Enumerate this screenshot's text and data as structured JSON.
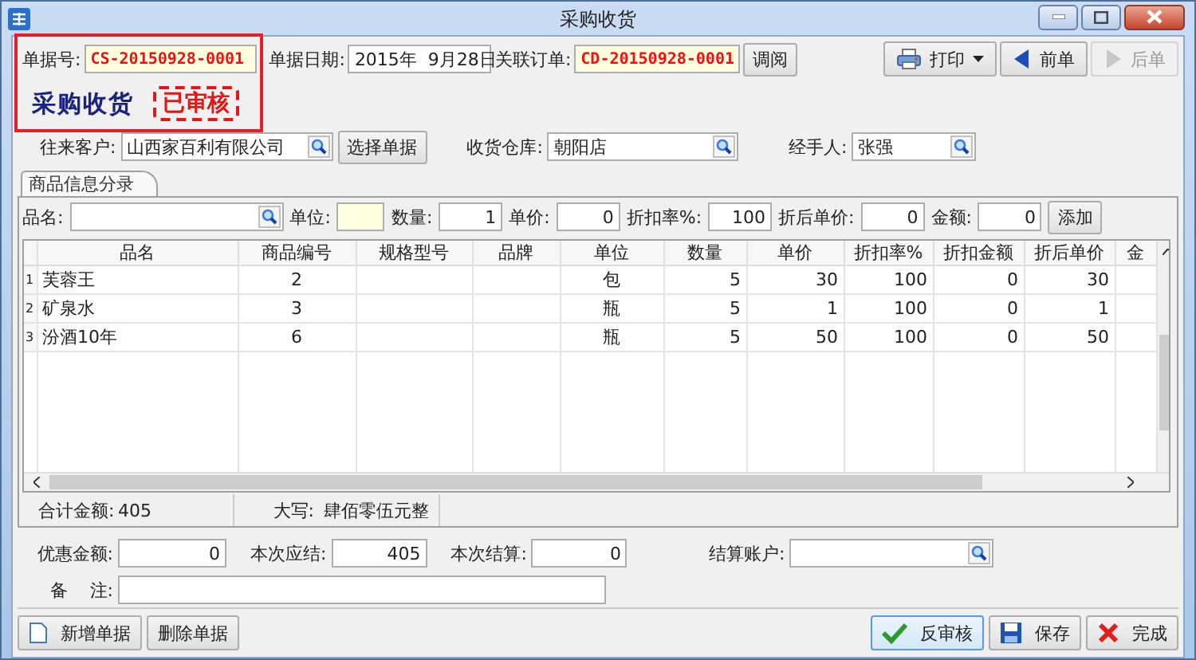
{
  "window": {
    "title": "采购收货"
  },
  "header": {
    "doc_no": {
      "label": "单据号:",
      "value": "CS-20150928-0001"
    },
    "date": {
      "label": "单据日期:",
      "value": "2015年  9月28日"
    },
    "related_order": {
      "label": "关联订单:",
      "value": "CD-20150928-0001"
    },
    "view_button": "调阅"
  },
  "toolbar": [
    {
      "label": "打印",
      "kind": "print",
      "disabled": false
    },
    {
      "label": "前单",
      "kind": "prev",
      "disabled": false
    },
    {
      "label": "后单",
      "kind": "next",
      "disabled": true
    }
  ],
  "doc_title": "采购收货",
  "status_stamp": "已审核",
  "party": {
    "customer": {
      "label": "往来客户:",
      "value": "山西家百利有限公司"
    },
    "select_button": "选择单据",
    "warehouse": {
      "label": "收货仓库:",
      "value": "朝阳店"
    },
    "handler": {
      "label": "经手人:",
      "value": "张强"
    }
  },
  "tabs": [
    {
      "label": "商品信息分录",
      "selected": true
    }
  ],
  "entry": {
    "fields": [
      {
        "label": "品名:",
        "kind": "lookup"
      },
      {
        "label": "单位:",
        "kind": "unit"
      },
      {
        "label": "数量:",
        "value": "1",
        "kind": "number"
      },
      {
        "label": "单价:",
        "value": "0",
        "kind": "number"
      },
      {
        "label": "折扣率%:",
        "value": "100",
        "kind": "number"
      },
      {
        "label": "折后单价:",
        "value": "0",
        "kind": "number"
      },
      {
        "label": "金额:",
        "value": "0",
        "kind": "number"
      }
    ],
    "add_button": "添加"
  },
  "table": {
    "columns": [
      "品名",
      "商品编号",
      "规格型号",
      "品牌",
      "单位",
      "数量",
      "单价",
      "折扣率%",
      "折扣金额",
      "折后单价",
      "金"
    ],
    "rows": [
      {
        "number": "1",
        "name": "芙蓉王",
        "code": "2",
        "unit": "包",
        "qty": "5",
        "price": "30",
        "discount_rate": "100",
        "discount_amount": "0",
        "net_price": "30"
      },
      {
        "number": "2",
        "name": "矿泉水",
        "code": "3",
        "unit": "瓶",
        "qty": "5",
        "price": "1",
        "discount_rate": "100",
        "discount_amount": "0",
        "net_price": "1"
      },
      {
        "number": "3",
        "name": "汾酒10年",
        "code": "6",
        "unit": "瓶",
        "qty": "5",
        "price": "50",
        "discount_rate": "100",
        "discount_amount": "0",
        "net_price": "50"
      }
    ]
  },
  "summary": {
    "total": {
      "label": "合计金额:",
      "value": "405"
    },
    "in_words": {
      "label": "大写:",
      "value": "肆佰零伍元整"
    }
  },
  "settlement": {
    "discount": {
      "label": "优惠金额:",
      "value": "0"
    },
    "payable": {
      "label": "本次应结:",
      "value": "405"
    },
    "settled": {
      "label": "本次结算:",
      "value": "0"
    },
    "account": {
      "label": "结算账户:"
    },
    "remark": {
      "label": "备    注:"
    }
  },
  "footer_left": [
    {
      "label": "新增单据",
      "kind": "new",
      "focused": false
    },
    {
      "label": "删除单据",
      "kind": "delete",
      "focused": false
    }
  ],
  "footer_right": [
    {
      "label": "反审核",
      "kind": "check",
      "focused": true
    },
    {
      "label": "保存",
      "kind": "save",
      "focused": false
    },
    {
      "label": "完成",
      "kind": "close",
      "focused": false
    }
  ]
}
